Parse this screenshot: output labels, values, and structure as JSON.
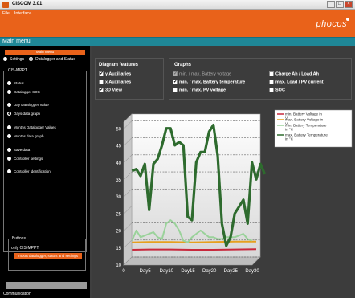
{
  "window": {
    "title": "CISCOM 3.01",
    "minimize": "_",
    "maximize": "□",
    "close": "×"
  },
  "menu": [
    "File",
    "Interface"
  ],
  "logo": "phocos",
  "main_title": "Main menu",
  "left": {
    "main_menu_btn": "Main menu",
    "top_radios": [
      {
        "label": "Settings",
        "selected": false
      },
      {
        "label": "Datalogger and Status",
        "selected": true
      }
    ],
    "group_title": "CIS-MPPT",
    "nav": [
      {
        "label": "Status",
        "selected": false
      },
      {
        "label": "Datalogger SOS",
        "selected": false
      },
      {
        "label": "Day Datalogger Value",
        "selected": false
      },
      {
        "label": "Days data graph",
        "selected": true
      },
      {
        "label": "Months Datalogger Values",
        "selected": false
      },
      {
        "label": "Months data graph",
        "selected": false
      },
      {
        "label": "Save data",
        "selected": false
      },
      {
        "label": "Controller settings",
        "selected": false
      },
      {
        "label": "Controller identification",
        "selected": false
      }
    ],
    "buttons_title": "Buttons",
    "only_label": "only CIS-MPPT:",
    "import_btn": "Import datalogger, status and settings",
    "communication": "Communication"
  },
  "diagram_features": {
    "title": "Diagram features",
    "items": [
      {
        "label": "y Auxiliaries",
        "checked": true
      },
      {
        "label": "x Auxiliaries",
        "checked": false
      },
      {
        "label": "3D View",
        "checked": true
      }
    ]
  },
  "graphs": {
    "title": "Graphs",
    "items": [
      {
        "label": "min. / max. Battery voltage",
        "checked": true,
        "disabled": true
      },
      {
        "label": "min. / max. Battery temperature",
        "checked": true,
        "disabled": false
      },
      {
        "label": "min. / max. PV voltage",
        "checked": false,
        "disabled": false
      },
      {
        "label": "Charge Ah / Load Ah",
        "checked": false,
        "disabled": false
      },
      {
        "label": "max. Load / PV current",
        "checked": false,
        "disabled": false
      },
      {
        "label": "SOC",
        "checked": false,
        "disabled": false
      }
    ]
  },
  "chart_data": {
    "type": "line",
    "x": [
      "0",
      "Day5",
      "Day10",
      "Day15",
      "Day20",
      "Day25",
      "Day30"
    ],
    "x_values": [
      0,
      5,
      10,
      15,
      20,
      25,
      30
    ],
    "ylim": [
      10,
      52
    ],
    "yticks": [
      10,
      15,
      20,
      25,
      30,
      35,
      40,
      45,
      50
    ],
    "legend": [
      {
        "name": "min. Battery Voltage in V",
        "color": "#c8283c"
      },
      {
        "name": "max. Battery Voltage in V",
        "color": "#e6a01e"
      },
      {
        "name": "min. Battery Temperature in °C",
        "color": "#9ad29a"
      },
      {
        "name": "max. Battery Temperature in °C",
        "color": "#2e6b2e"
      }
    ],
    "series": [
      {
        "name": "min. Battery Voltage in V",
        "color": "#c8283c",
        "points": [
          [
            1,
            13.3
          ],
          [
            5,
            13.4
          ],
          [
            10,
            13.4
          ],
          [
            15,
            13.3
          ],
          [
            20,
            13.3
          ],
          [
            25,
            13.4
          ],
          [
            30,
            13.5
          ]
        ]
      },
      {
        "name": "max. Battery Voltage in V",
        "color": "#e6a01e",
        "points": [
          [
            1,
            15.5
          ],
          [
            5,
            15.6
          ],
          [
            10,
            15.6
          ],
          [
            15,
            15.5
          ],
          [
            20,
            15.6
          ],
          [
            25,
            15.7
          ],
          [
            30,
            15.7
          ]
        ]
      },
      {
        "name": "min. Battery Temperature in °C",
        "color": "#9ad29a",
        "points": [
          [
            1,
            16
          ],
          [
            2,
            19
          ],
          [
            3,
            17
          ],
          [
            4,
            17.5
          ],
          [
            5,
            18
          ],
          [
            6,
            18.5
          ],
          [
            7,
            17
          ],
          [
            8,
            16.5
          ],
          [
            9,
            21
          ],
          [
            10,
            22
          ],
          [
            11,
            21
          ],
          [
            12,
            19
          ],
          [
            13,
            16
          ],
          [
            14,
            15.5
          ],
          [
            15,
            17
          ],
          [
            16,
            18
          ],
          [
            17,
            19
          ],
          [
            18,
            18
          ],
          [
            19,
            17
          ],
          [
            20,
            17
          ],
          [
            21,
            16.5
          ],
          [
            22,
            16.5
          ],
          [
            23,
            17
          ],
          [
            24,
            17
          ],
          [
            25,
            17
          ],
          [
            26,
            17.5
          ],
          [
            27,
            18
          ],
          [
            28,
            16.5
          ],
          [
            29,
            16
          ]
        ]
      },
      {
        "name": "max. Battery Temperature in °C",
        "color": "#2e6b2e",
        "points": [
          [
            1,
            36.5
          ],
          [
            2,
            37
          ],
          [
            3,
            35
          ],
          [
            4,
            38.5
          ],
          [
            5,
            25
          ],
          [
            6,
            38.5
          ],
          [
            7,
            40
          ],
          [
            8,
            44
          ],
          [
            9,
            49
          ],
          [
            10,
            49
          ],
          [
            11,
            44
          ],
          [
            12,
            45
          ],
          [
            13,
            44
          ],
          [
            14,
            23
          ],
          [
            15,
            22
          ],
          [
            16,
            39
          ],
          [
            17,
            42
          ],
          [
            18,
            42
          ],
          [
            19,
            48
          ],
          [
            20,
            50
          ],
          [
            21,
            41
          ],
          [
            22,
            21
          ],
          [
            23,
            14.5
          ],
          [
            24,
            17
          ],
          [
            25,
            24
          ],
          [
            26,
            26
          ],
          [
            27,
            28
          ],
          [
            28,
            21
          ],
          [
            29,
            39
          ],
          [
            30,
            34
          ],
          [
            31,
            38.5
          ],
          [
            32,
            35.5
          ]
        ]
      }
    ]
  }
}
